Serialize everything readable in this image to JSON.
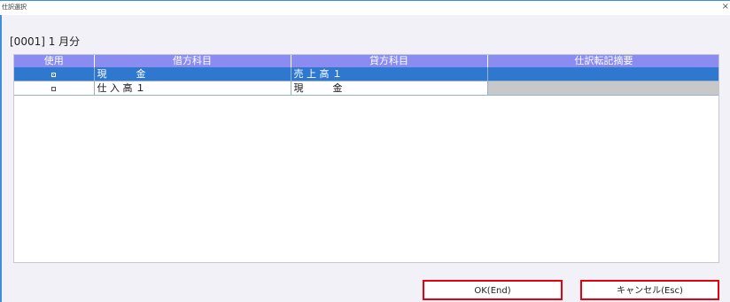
{
  "window": {
    "title": "仕訳選択",
    "close_glyph": "×"
  },
  "header": {
    "label": "[0001] 1 月分"
  },
  "table": {
    "columns": [
      "使用",
      "借方科目",
      "貸方科目",
      "仕訳転記摘要"
    ],
    "rows": [
      {
        "checked": true,
        "debit": "現　　　金",
        "credit": "売 上 高 １",
        "memo": "",
        "selected": true
      },
      {
        "checked": false,
        "debit": "仕 入 高 １",
        "credit": "現　　　金",
        "memo": "",
        "selected": false
      }
    ]
  },
  "buttons": {
    "ok_label": "OK(End)",
    "cancel_label": "キャンセル(Esc)"
  },
  "colors": {
    "header_bg": "#8a8cf2",
    "selected_row": "#2f78d0",
    "button_highlight": "#e8000f",
    "title_accent": "#3c8fd8"
  }
}
